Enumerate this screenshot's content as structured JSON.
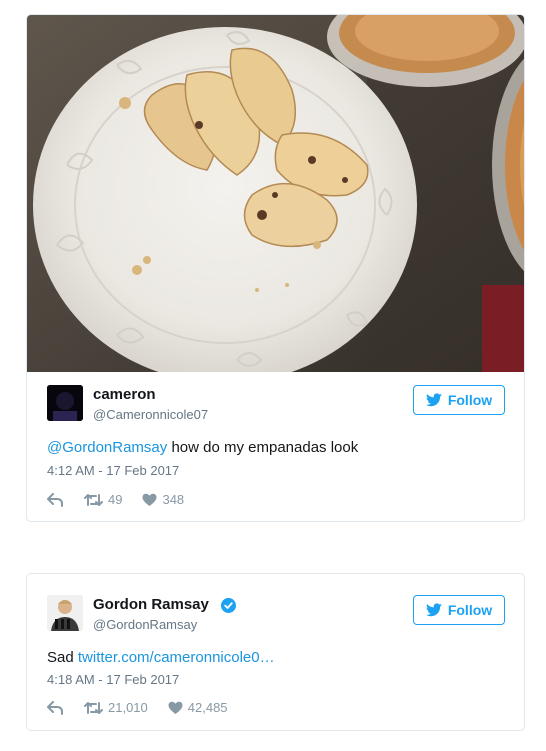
{
  "colors": {
    "twitter_blue": "#1da1f2",
    "link_blue": "#1b95e0",
    "muted": "#657786",
    "icon_gray": "#8899a6",
    "verified": "#1da1f2"
  },
  "tweets": [
    {
      "author_name": "cameron",
      "author_handle": "@Cameronnicole07",
      "follow_label": "Follow",
      "mention": "@GordonRamsay",
      "body": " how do my empanadas look",
      "timestamp": "4:12 AM - 17 Feb 2017",
      "retweets": "49",
      "likes": "348",
      "icons": [
        "reply-icon",
        "retweet-icon",
        "heart-icon"
      ]
    },
    {
      "author_name": "Gordon Ramsay",
      "author_handle": "@GordonRamsay",
      "verified": true,
      "follow_label": "Follow",
      "body_prefix": "Sad ",
      "link_text": "twitter.com/cameronnicole0…",
      "timestamp": "4:18 AM - 17 Feb 2017",
      "retweets": "21,010",
      "likes": "42,485",
      "icons": [
        "reply-icon",
        "retweet-icon",
        "heart-icon"
      ]
    }
  ]
}
